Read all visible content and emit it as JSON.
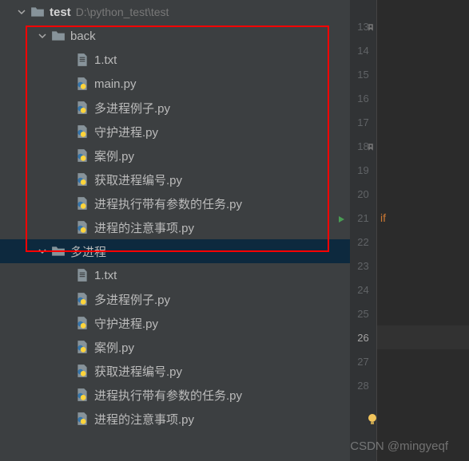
{
  "root": {
    "name": "test",
    "path": "D:\\python_test\\test"
  },
  "back_folder": {
    "name": "back",
    "files": [
      "1.txt",
      "main.py",
      "多进程例子.py",
      "守护进程.py",
      "案例.py",
      "获取进程编号.py",
      "进程执行带有参数的任务.py",
      "进程的注意事项.py"
    ]
  },
  "mp_folder": {
    "name": "多进程",
    "files": [
      "1.txt",
      "多进程例子.py",
      "守护进程.py",
      "案例.py",
      "获取进程编号.py",
      "进程执行带有参数的任务.py",
      "进程的注意事项.py"
    ]
  },
  "gutter": {
    "lines": [
      13,
      14,
      15,
      16,
      17,
      18,
      19,
      20,
      21,
      22,
      23,
      24,
      25,
      26,
      27,
      28
    ],
    "current_line": 26,
    "play_line": 21,
    "bookmark_lines": [
      13,
      18
    ]
  },
  "code": {
    "line21": "if"
  },
  "watermark": "CSDN @mingyeqf"
}
